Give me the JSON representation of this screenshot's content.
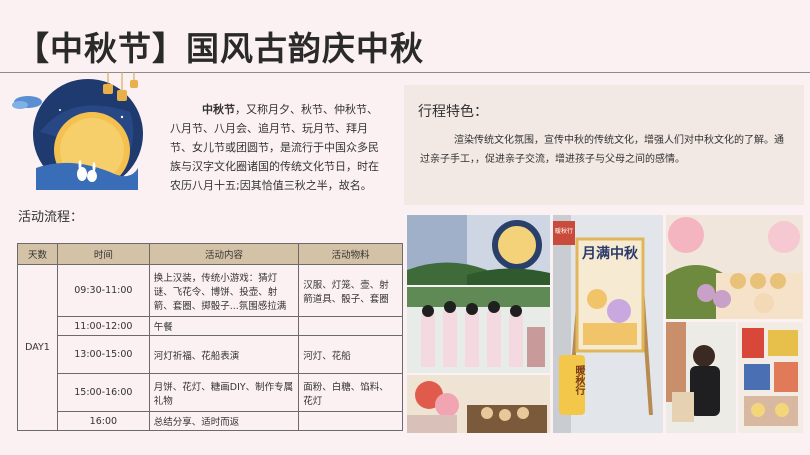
{
  "header": {
    "title": "【中秋节】国风古韵庆中秋"
  },
  "intro": {
    "lead": "中秋节",
    "body": "，又称月夕、秋节、仲秋节、八月节、八月会、追月节、玩月节、拜月节、女儿节或团圆节，是流行于中国众多民族与汉字文化圈诸国的传统文化节日，时在农历八月十五;因其恰值三秋之半，故名。"
  },
  "features": {
    "title": "行程特色：",
    "text": "渲染传统文化氛围，宣传中秋的传统文化，增强人们对中秋文化的了解。通过亲子手工，，促进亲子交流，增进孩子与父母之间的感情。"
  },
  "flow": {
    "title": "活动流程：",
    "headers": [
      "天数",
      "时间",
      "活动内容",
      "活动物料"
    ],
    "day": "DAY1",
    "rows": [
      {
        "time": "09:30-11:00",
        "content": "换上汉装，传统小游戏：猜灯谜、飞花令、博饼、投壶、射箭、套圈、掷骰子...氛围感拉满",
        "materials": "汉服、灯笼、壶、射箭道具、骰子、套圈"
      },
      {
        "time": "11:00-12:00",
        "content": "午餐",
        "materials": ""
      },
      {
        "time": "13:00-15:00",
        "content": "河灯祈福、花船表演",
        "materials": "河灯、花船"
      },
      {
        "time": "15:00-16:00",
        "content": "月饼、花灯、糖画DIY、制作专属礼物",
        "materials": "面粉、白糖、馅料、花灯"
      },
      {
        "time": "16:00",
        "content": "总结分享、适时而返",
        "materials": ""
      }
    ]
  },
  "photos": {
    "easel_sign": "月满中秋",
    "badge": "暖秋行",
    "logo": "暖秋行"
  },
  "colors": {
    "background": "#fbf1f3",
    "table_header": "#d4c2a6",
    "feature_box": "#f2e8e4",
    "moon": "#f4c050",
    "night": "#1e3a6e"
  }
}
